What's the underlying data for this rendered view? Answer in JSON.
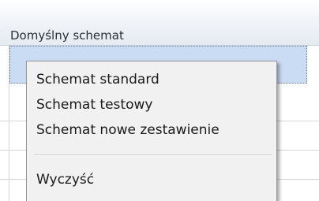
{
  "grid": {
    "column_header": "Domyślny schemat"
  },
  "context_menu": {
    "items": [
      {
        "label": "Schemat standard"
      },
      {
        "label": "Schemat testowy"
      },
      {
        "label": "Schemat nowe zestawienie"
      }
    ],
    "clear_label": "Wyczyść"
  },
  "colors": {
    "selection": "#c9dcf3",
    "menu_background": "#f1f1f1"
  }
}
